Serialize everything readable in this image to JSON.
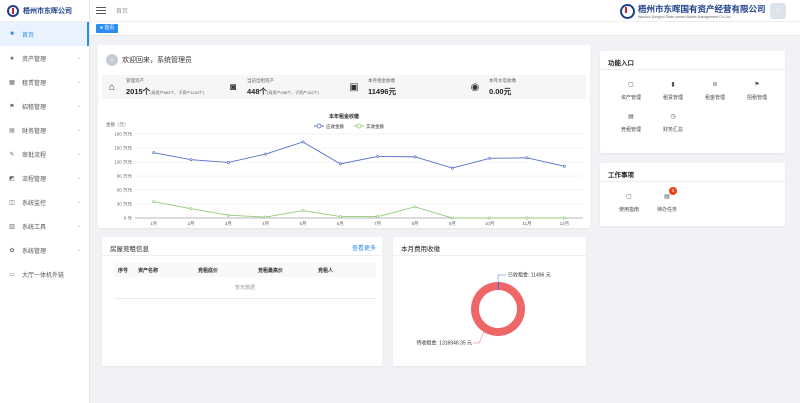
{
  "brand": {
    "sidebar_title": "梧州市东晖公司",
    "header_name": "梧州市东晖国有资产经营有限公司",
    "header_name_en": "Wuzhou Donghui State-owned Assets Management Co.,Ltd"
  },
  "sidebar": {
    "items": [
      {
        "label": "首页",
        "icon": "home-icon",
        "glyph": "■",
        "active": true,
        "arrow": false
      },
      {
        "label": "资产管理",
        "icon": "star-icon",
        "glyph": "★",
        "active": false,
        "arrow": true
      },
      {
        "label": "租赁管理",
        "icon": "building-icon",
        "glyph": "▦",
        "active": false,
        "arrow": true
      },
      {
        "label": "招租管理",
        "icon": "flag-icon",
        "glyph": "⚑",
        "active": false,
        "arrow": true
      },
      {
        "label": "财务管理",
        "icon": "printer-icon",
        "glyph": "▤",
        "active": false,
        "arrow": true
      },
      {
        "label": "审批流程",
        "icon": "edit-icon",
        "glyph": "✎",
        "active": false,
        "arrow": true
      },
      {
        "label": "流程管理",
        "icon": "workflow-icon",
        "glyph": "◩",
        "active": false,
        "arrow": true
      },
      {
        "label": "系统监控",
        "icon": "monitor-icon",
        "glyph": "◫",
        "active": false,
        "arrow": true
      },
      {
        "label": "系统工具",
        "icon": "tool-icon",
        "glyph": "▥",
        "active": false,
        "arrow": true
      },
      {
        "label": "系统管理",
        "icon": "gear-icon",
        "glyph": "✿",
        "active": false,
        "arrow": true
      },
      {
        "label": "大厅一体机外链",
        "icon": "screen-icon",
        "glyph": "▭",
        "active": false,
        "arrow": false
      }
    ]
  },
  "header": {
    "breadcrumb": "首页",
    "avatar_glyph": "☺"
  },
  "tabs": [
    {
      "label": "● 首页",
      "active": true
    }
  ],
  "welcome": {
    "text": "欢迎回来，系统管理员",
    "avatar_glyph": "☺"
  },
  "stats": [
    {
      "label": "管理资产",
      "value": "2015个",
      "detail": "(母资产883个、子资产1130个)",
      "icon": "house-icon",
      "glyph": "⌂"
    },
    {
      "label": "当前出租资产",
      "value": "448个",
      "detail": "(母资产296个、子资产152个)",
      "icon": "door-icon",
      "glyph": "◙"
    },
    {
      "label": "本月租金收缴",
      "value": "11496元",
      "detail": "",
      "icon": "wallet-icon",
      "glyph": "▣"
    },
    {
      "label": "本月水电收缴",
      "value": "0.00元",
      "detail": "",
      "icon": "drop-icon",
      "glyph": "◉"
    }
  ],
  "chart_data": {
    "type": "line",
    "title": "本年租金收缴",
    "ylabel": "金额（元）",
    "categories": [
      "1月",
      "2月",
      "3月",
      "4月",
      "5月",
      "6月",
      "7月",
      "8月",
      "9月",
      "10月",
      "11月",
      "12月"
    ],
    "ylim": [
      0,
      180
    ],
    "yticks": [
      0,
      15,
      30,
      45,
      60,
      75,
      90,
      105,
      120,
      135,
      150,
      165,
      180
    ],
    "ytick_labels": [
      "0 元",
      "15 万元",
      "30 万元",
      "45 万元",
      "60 万元",
      "75 万元",
      "90 万元",
      "105 万元",
      "120 万元",
      "135 万元",
      "150 万元",
      "165 万元",
      "180 万元"
    ],
    "legend_position": "top-center",
    "series": [
      {
        "name": "应收金额",
        "color": "#5470c6",
        "values": [
          140,
          125,
          119,
          137,
          163,
          116,
          132,
          131,
          107,
          128,
          129,
          111
        ]
      },
      {
        "name": "实收金额",
        "color": "#91cc75",
        "values": [
          35,
          20,
          6,
          2,
          16,
          3,
          3,
          24,
          0,
          0,
          0,
          0
        ]
      }
    ]
  },
  "functions": {
    "title": "功能入口",
    "items": [
      {
        "label": "资产管理",
        "icon": "box-icon",
        "glyph": "▢"
      },
      {
        "label": "租赁管理",
        "icon": "bar-chart-icon",
        "glyph": "▮"
      },
      {
        "label": "租金管理",
        "icon": "car-icon",
        "glyph": "⊜"
      },
      {
        "label": "招租管理",
        "icon": "flag-icon",
        "glyph": "⚑"
      },
      {
        "label": "竞租管理",
        "icon": "printer-icon",
        "glyph": "▤"
      },
      {
        "label": "财务汇总",
        "icon": "clock-icon",
        "glyph": "◷"
      }
    ]
  },
  "work": {
    "title": "工作事项",
    "items": [
      {
        "label": "使用指南",
        "icon": "guide-icon",
        "glyph": "▢",
        "badge": ""
      },
      {
        "label": "待办任务",
        "icon": "task-icon",
        "glyph": "▤",
        "badge": "0"
      }
    ]
  },
  "rent_info": {
    "title": "房屋竞租信息",
    "more_label": "查看更多",
    "columns": [
      "序号",
      "资产名称",
      "竞租底价",
      "竞租最高价",
      "竞租人"
    ],
    "empty_text": "暂无数据"
  },
  "fee": {
    "title": "本月费用收缴",
    "chart_data": {
      "type": "pie",
      "slices": [
        {
          "label": "已收租金",
          "value": 11496,
          "display": "已收租金: 11496 元",
          "color": "#5470c6"
        },
        {
          "label": "待收租金",
          "value": 1316946.35,
          "display": "待收租金: 1316946.35 元",
          "color": "#ee6666"
        }
      ]
    }
  }
}
